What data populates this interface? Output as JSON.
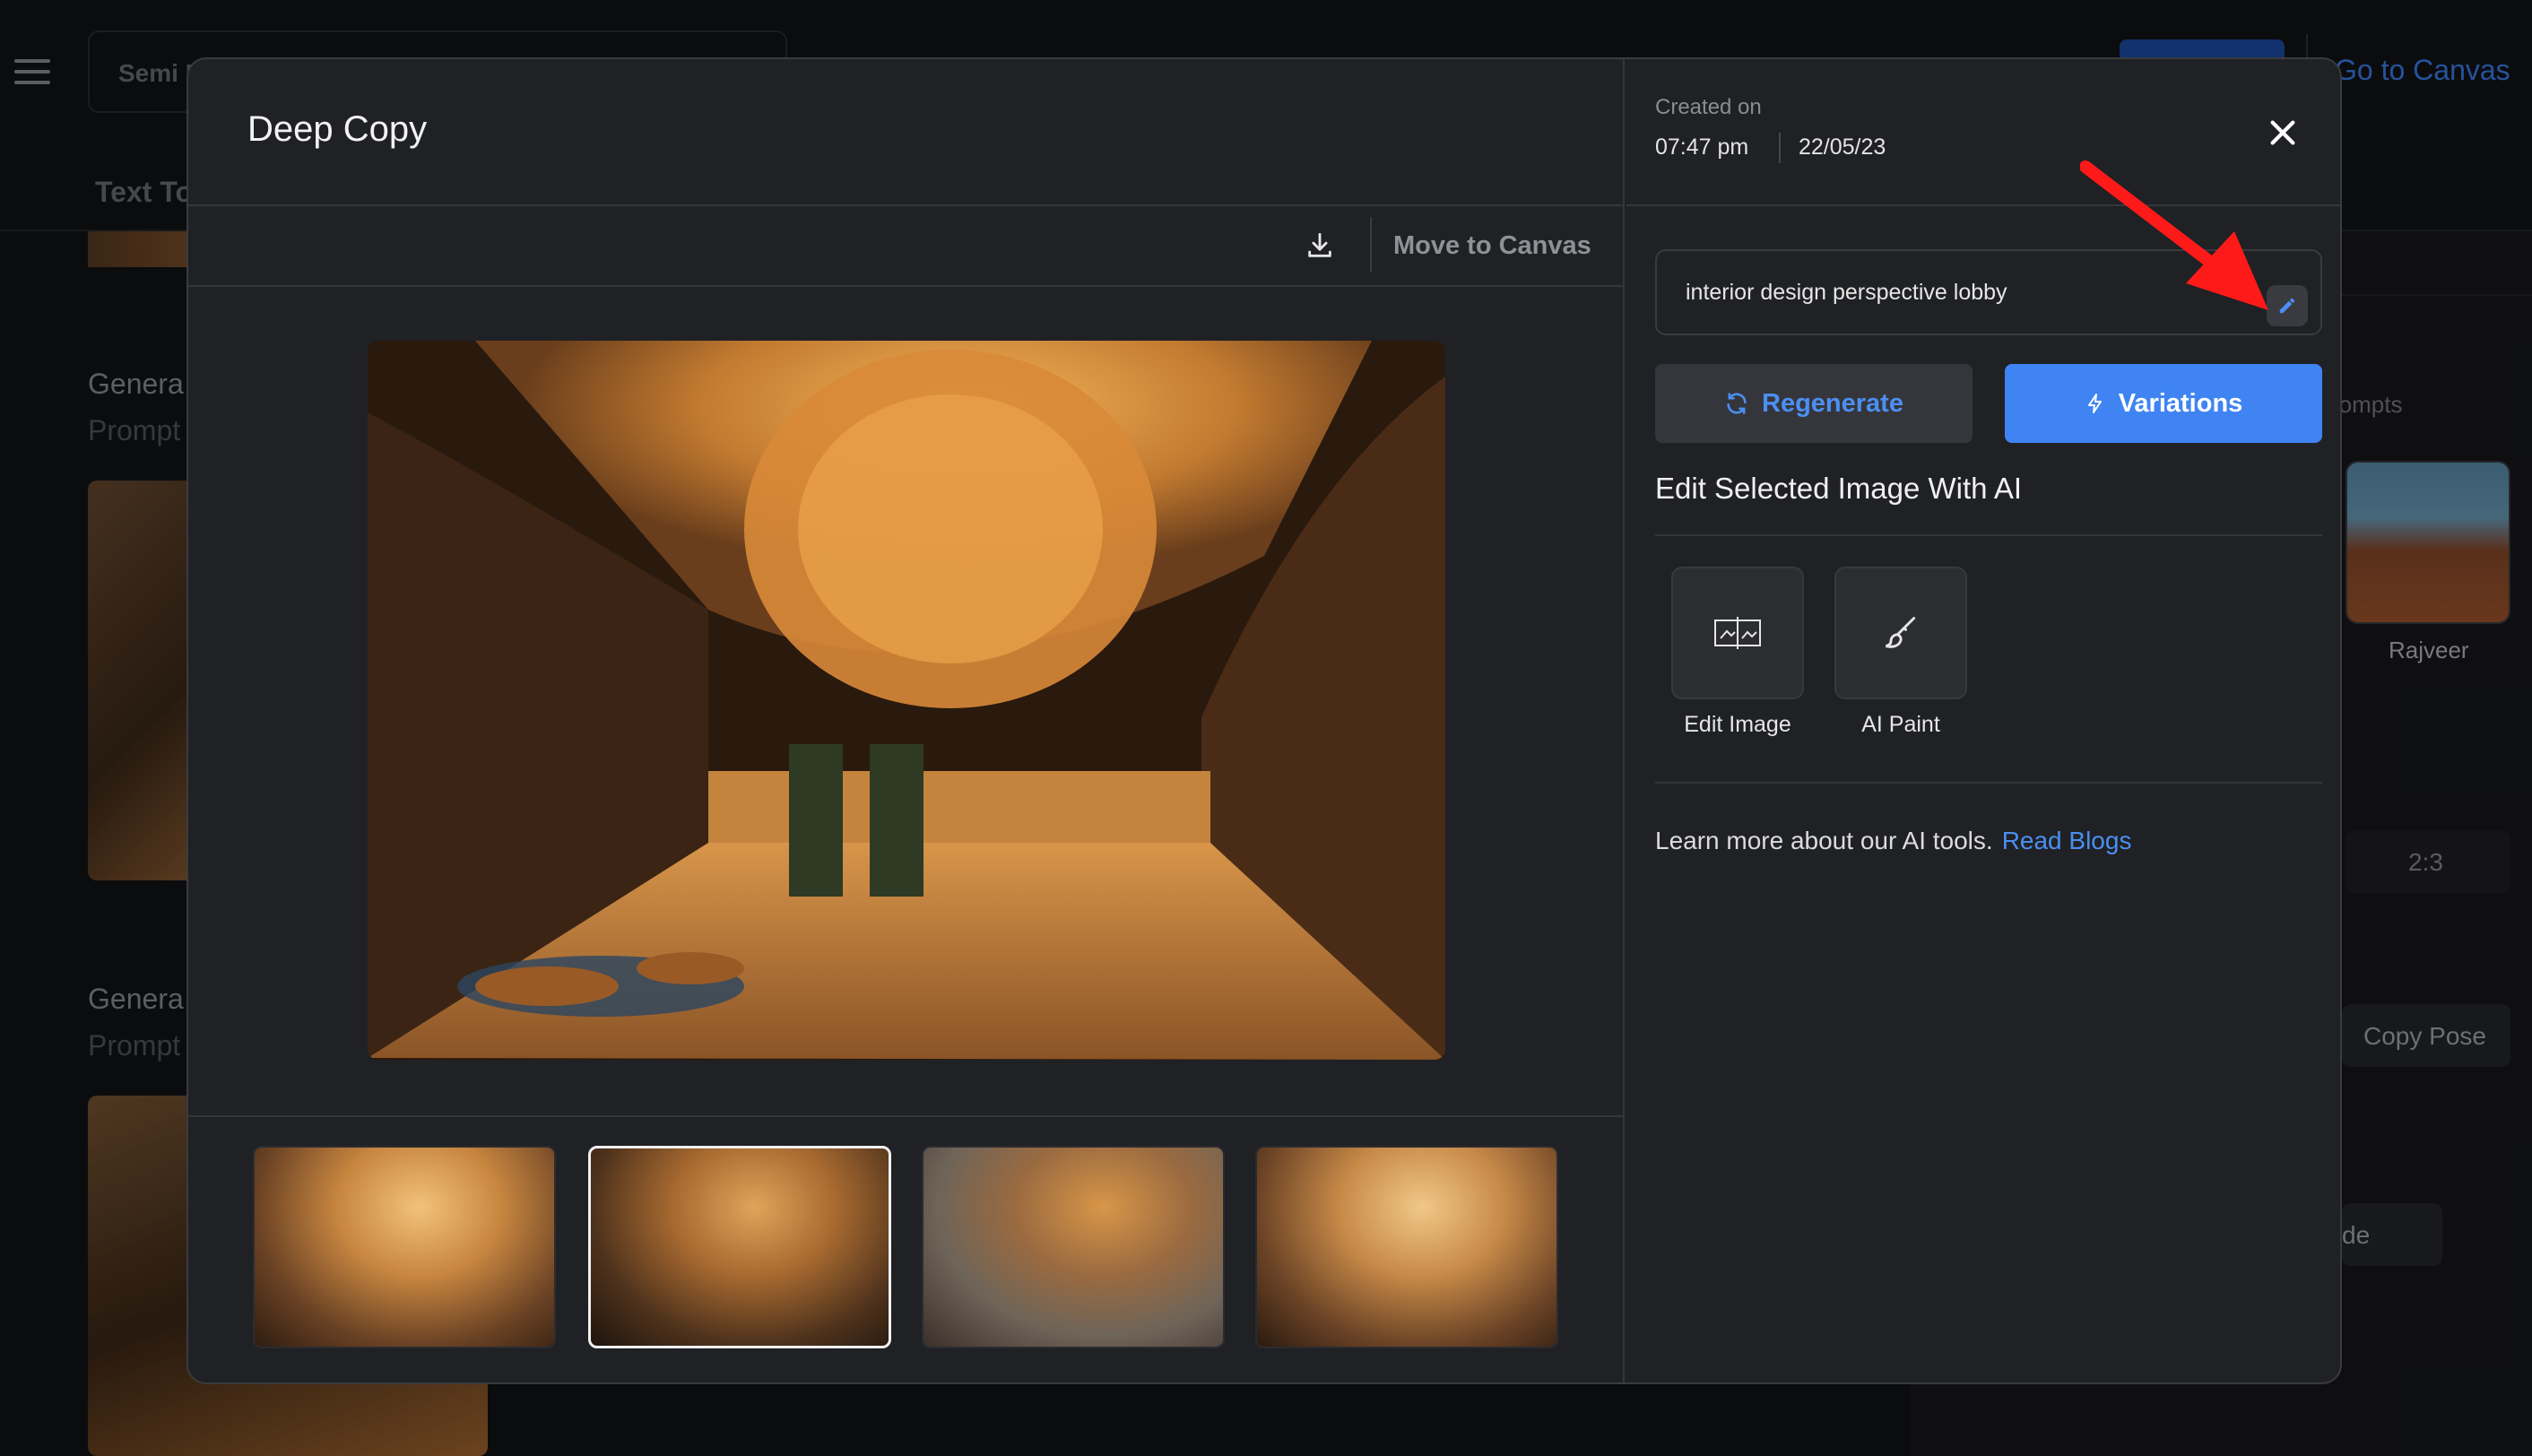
{
  "background": {
    "dropdown_label": "Semi R",
    "go_to_canvas": "Go to Canvas",
    "text_tab": "Text To",
    "generate_label_1": "Genera",
    "prompt_label_1": "Prompt",
    "generate_label_2": "Genera",
    "prompt_label_2": "Prompt",
    "prompts_label": "rompts",
    "avatar_name": "Rajveer",
    "ratio": "2:3",
    "copy_pose": "Copy Pose",
    "mode_fragment": "de"
  },
  "modal": {
    "title": "Deep Copy",
    "toolbar": {
      "download_icon": "download-icon",
      "move_to_canvas": "Move to Canvas"
    },
    "main_image_desc": "interior-lobby-render",
    "thumbnails": [
      {
        "name": "variation-1",
        "selected": false
      },
      {
        "name": "variation-2",
        "selected": true
      },
      {
        "name": "variation-3",
        "selected": false
      },
      {
        "name": "variation-4",
        "selected": false
      }
    ],
    "details": {
      "created_label": "Created on",
      "created_time": "07:47 pm",
      "created_date": "22/05/23",
      "prompt": "interior design perspective lobby",
      "regenerate": "Regenerate",
      "variations": "Variations",
      "edit_heading": "Edit Selected Image With AI",
      "tools": [
        {
          "label": "Edit Image",
          "icon": "edit-image-icon"
        },
        {
          "label": "AI Paint",
          "icon": "brush-icon"
        }
      ],
      "learn_more": "Learn more about our AI tools.",
      "read_blogs": "Read Blogs"
    }
  },
  "colors": {
    "accent": "#3f84f2",
    "link": "#4b8ff2",
    "modal_bg": "#202124",
    "annotation": "#ff1a1a"
  }
}
